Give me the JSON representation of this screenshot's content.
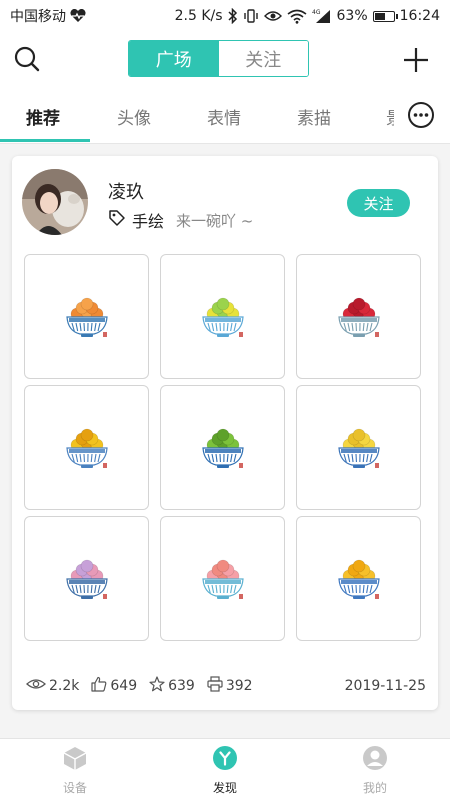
{
  "status_bar": {
    "carrier": "中国移动",
    "speed": "2.5 K/s",
    "network": "4G",
    "battery_percent": "63%",
    "battery_level": 0.63,
    "time": "16:24"
  },
  "header": {
    "segments": [
      {
        "label": "广场",
        "active": true
      },
      {
        "label": "关注",
        "active": false
      }
    ],
    "search_icon": "search-icon",
    "add_icon": "plus-icon"
  },
  "tabs": [
    {
      "label": "推荐",
      "active": true
    },
    {
      "label": "头像",
      "active": false
    },
    {
      "label": "表情",
      "active": false
    },
    {
      "label": "素描",
      "active": false
    },
    {
      "label": "景",
      "active": false
    }
  ],
  "post": {
    "user_name": "凌玖",
    "tag": "手绘",
    "description": "来一碗吖 ~",
    "follow_label": "关注",
    "images": [
      {
        "fruit": "#ef8a34",
        "fruit2": "#f6a24a",
        "bowl": "#3a7ab4"
      },
      {
        "fruit": "#e6e23a",
        "fruit2": "#9bd34c",
        "bowl": "#5aa8d6"
      },
      {
        "fruit": "#d8283a",
        "fruit2": "#b81a2c",
        "bowl": "#7a9fb0"
      },
      {
        "fruit": "#f2c21f",
        "fruit2": "#e5a010",
        "bowl": "#4b82c0"
      },
      {
        "fruit": "#7cc23b",
        "fruit2": "#5ea12a",
        "bowl": "#2f6fb3"
      },
      {
        "fruit": "#f5d640",
        "fruit2": "#e9c02a",
        "bowl": "#3a73b8"
      },
      {
        "fruit": "#e89ab8",
        "fruit2": "#c7a0d8",
        "bowl": "#3e6fa8"
      },
      {
        "fruit": "#f6a0a6",
        "fruit2": "#f08a80",
        "bowl": "#5ab0d0"
      },
      {
        "fruit": "#f6c02a",
        "fruit2": "#f0a812",
        "bowl": "#3f78c0"
      }
    ],
    "stats": {
      "views": "2.2k",
      "likes": "649",
      "favorites": "639",
      "prints": "392"
    },
    "date": "2019-11-25"
  },
  "bottom_nav": [
    {
      "label": "设备",
      "active": false
    },
    {
      "label": "发现",
      "active": true
    },
    {
      "label": "我的",
      "active": false
    }
  ],
  "colors": {
    "accent": "#2fc4b2",
    "text": "#222222",
    "muted": "#888888"
  }
}
